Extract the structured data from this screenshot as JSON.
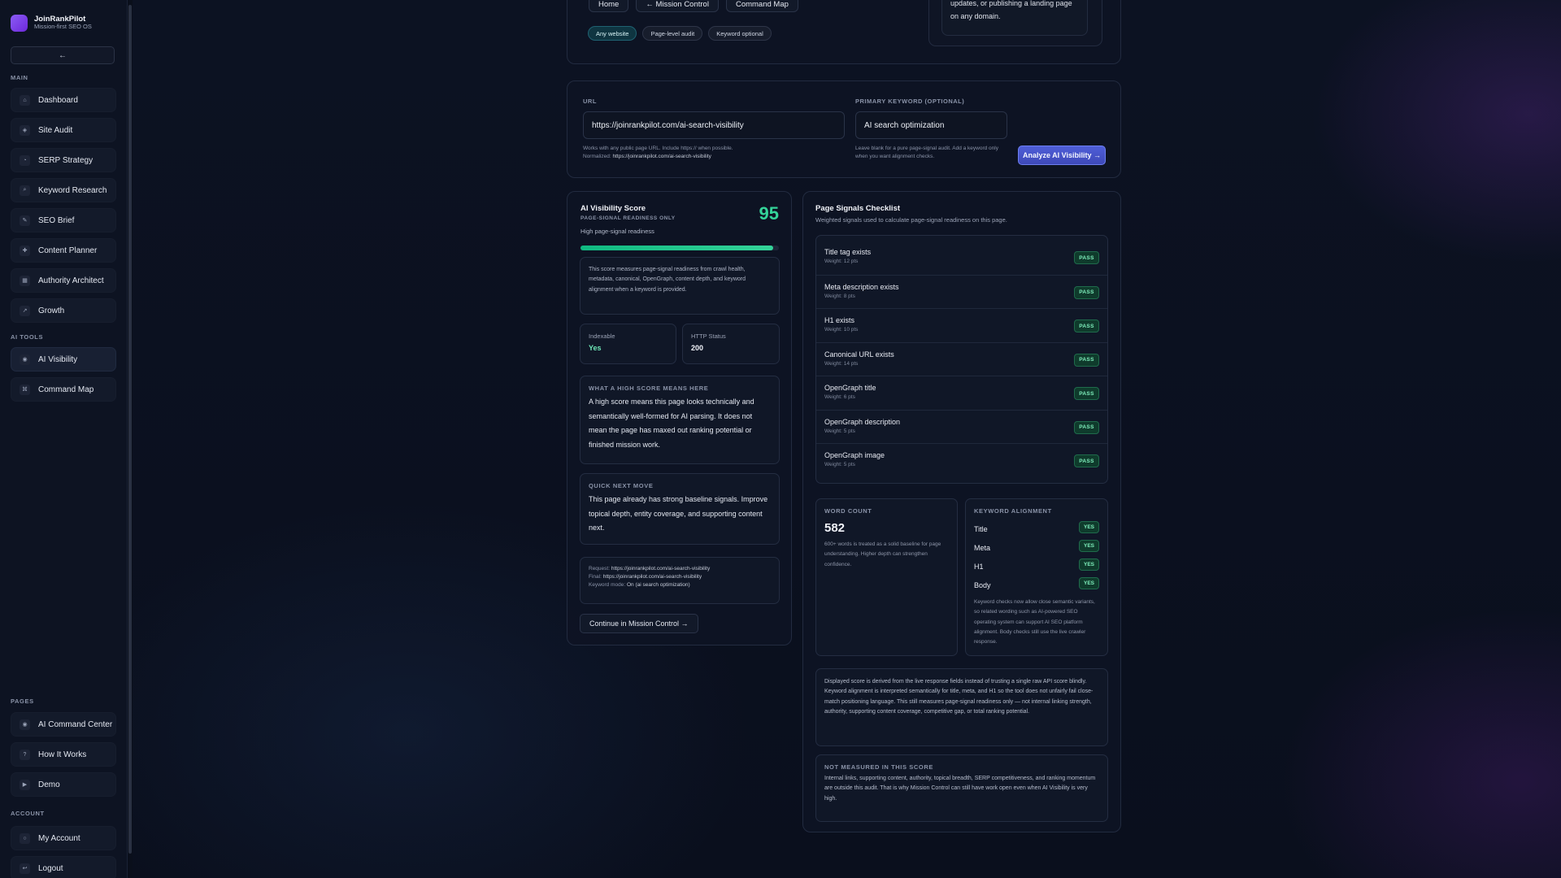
{
  "brand": {
    "name": "JoinRankPilot",
    "tagline": "Mission-first SEO OS",
    "collapse_label": "←"
  },
  "sidebar": {
    "sections": {
      "main": "MAIN",
      "ai_tools": "AI TOOLS",
      "pages": "PAGES",
      "account": "ACCOUNT"
    },
    "main_items": [
      {
        "label": "Dashboard",
        "icon": "home-icon",
        "glyph": "⌂"
      },
      {
        "label": "Site Audit",
        "icon": "audit-icon",
        "glyph": "◈"
      },
      {
        "label": "SERP Strategy",
        "icon": "strategy-icon",
        "glyph": "◔"
      },
      {
        "label": "Keyword Research",
        "icon": "search-icon",
        "glyph": "⌕"
      },
      {
        "label": "SEO Brief",
        "icon": "pen-icon",
        "glyph": "✎"
      },
      {
        "label": "Content Planner",
        "icon": "plus-icon",
        "glyph": "✚"
      },
      {
        "label": "Authority Architect",
        "icon": "building-icon",
        "glyph": "▦"
      },
      {
        "label": "Growth",
        "icon": "trend-icon",
        "glyph": "↗"
      }
    ],
    "ai_items": [
      {
        "label": "AI Visibility",
        "icon": "eye-icon",
        "glyph": "◉"
      },
      {
        "label": "Command Map",
        "icon": "command-icon",
        "glyph": "⌘"
      }
    ],
    "page_items": [
      {
        "label": "AI Command Center",
        "icon": "target-icon",
        "glyph": "◉"
      },
      {
        "label": "How It Works",
        "icon": "question-icon",
        "glyph": "?"
      },
      {
        "label": "Demo",
        "icon": "play-icon",
        "glyph": "▶"
      }
    ],
    "account_items": [
      {
        "label": "My Account",
        "icon": "user-icon",
        "glyph": "○"
      },
      {
        "label": "Logout",
        "icon": "logout-icon",
        "glyph": "↩"
      }
    ]
  },
  "top_nav": {
    "home": "Home",
    "mission_control": "← Mission Control",
    "command_map": "Command Map"
  },
  "chips": [
    "Any website",
    "Page-level audit",
    "Keyword optional"
  ],
  "hero_note": {
    "line1": "updates, or publishing a landing page",
    "line2": "on any domain."
  },
  "form": {
    "url_label": "URL",
    "url_value": "https://joinrankpilot.com/ai-search-visibility",
    "url_hint": "Works with any public page URL. Include https:// when possible.",
    "normalized_label": "Normalized:",
    "normalized_value": "https://joinrankpilot.com/ai-search-visibility",
    "keyword_label": "PRIMARY KEYWORD (OPTIONAL)",
    "keyword_value": "AI search optimization",
    "keyword_hint_1": "Leave blank for a pure page-signal audit. Add a keyword only",
    "keyword_hint_2": "when you want alignment checks.",
    "analyze_button": "Analyze AI Visibility →"
  },
  "score": {
    "title": "AI Visibility Score",
    "subtitle": "PAGE-SIGNAL READINESS ONLY",
    "level": "High page-signal readiness",
    "value": "95",
    "progress": 0.97,
    "accent": "#34d399",
    "description": "This score measures page-signal readiness from crawl health, metadata, canonical, OpenGraph, content depth, and keyword alignment when a keyword is provided.",
    "indexable_label": "Indexable",
    "indexable_value": "Yes",
    "http_label": "HTTP Status",
    "http_value": "200",
    "high_score_heading": "WHAT A HIGH SCORE MEANS HERE",
    "high_score_text": "A high score means this page looks technically and semantically well-formed for AI parsing. It does not mean the page has maxed out ranking potential or finished mission work.",
    "next_move_heading": "QUICK NEXT MOVE",
    "next_move_text": "This page already has strong baseline signals. Improve topical depth, entity coverage, and supporting content next.",
    "request_label": "Request:",
    "request_value": "https://joinrankpilot.com/ai-search-visibility",
    "final_label": "Final:",
    "final_value": "https://joinrankpilot.com/ai-search-visibility",
    "mode_label": "Keyword mode:",
    "mode_value": "On (ai search optimization)",
    "continue_button": "Continue in Mission Control →"
  },
  "checklist": {
    "title": "Page Signals Checklist",
    "subtitle": "Weighted signals used to calculate page-signal readiness on this page.",
    "items": [
      {
        "name": "Title tag exists",
        "weight": "Weight: 12 pts",
        "status": "PASS"
      },
      {
        "name": "Meta description exists",
        "weight": "Weight: 8 pts",
        "status": "PASS"
      },
      {
        "name": "H1 exists",
        "weight": "Weight: 10 pts",
        "status": "PASS"
      },
      {
        "name": "Canonical URL exists",
        "weight": "Weight: 14 pts",
        "status": "PASS"
      },
      {
        "name": "OpenGraph title",
        "weight": "Weight: 6 pts",
        "status": "PASS"
      },
      {
        "name": "OpenGraph description",
        "weight": "Weight: 5 pts",
        "status": "PASS"
      },
      {
        "name": "OpenGraph image",
        "weight": "Weight: 5 pts",
        "status": "PASS"
      }
    ]
  },
  "word_count": {
    "heading": "WORD COUNT",
    "value": "582",
    "note": "600+ words is treated as a solid baseline for page understanding. Higher depth can strengthen confidence."
  },
  "keyword_alignment": {
    "heading": "KEYWORD ALIGNMENT",
    "rows": [
      {
        "label": "Title",
        "value": "YES"
      },
      {
        "label": "Meta",
        "value": "YES"
      },
      {
        "label": "H1",
        "value": "YES"
      },
      {
        "label": "Body",
        "value": "YES"
      }
    ],
    "note": "Keyword checks now allow close semantic variants, so related wording such as AI-powered SEO operating system can support AI SEO platform alignment. Body checks still use the live crawler response."
  },
  "derived_note": "Displayed score is derived from the live response fields instead of trusting a single raw API score blindly. Keyword alignment is interpreted semantically for title, meta, and H1 so the tool does not unfairly fail close-match positioning language. This still measures page-signal readiness only — not internal linking strength, authority, supporting content coverage, competitive gap, or total ranking potential.",
  "not_measured": {
    "heading": "NOT MEASURED IN THIS SCORE",
    "text": "Internal links, supporting content, authority, topical breadth, SERP competitiveness, and ranking momentum are outside this audit. That is why Mission Control can still have work open even when AI Visibility is very high."
  }
}
